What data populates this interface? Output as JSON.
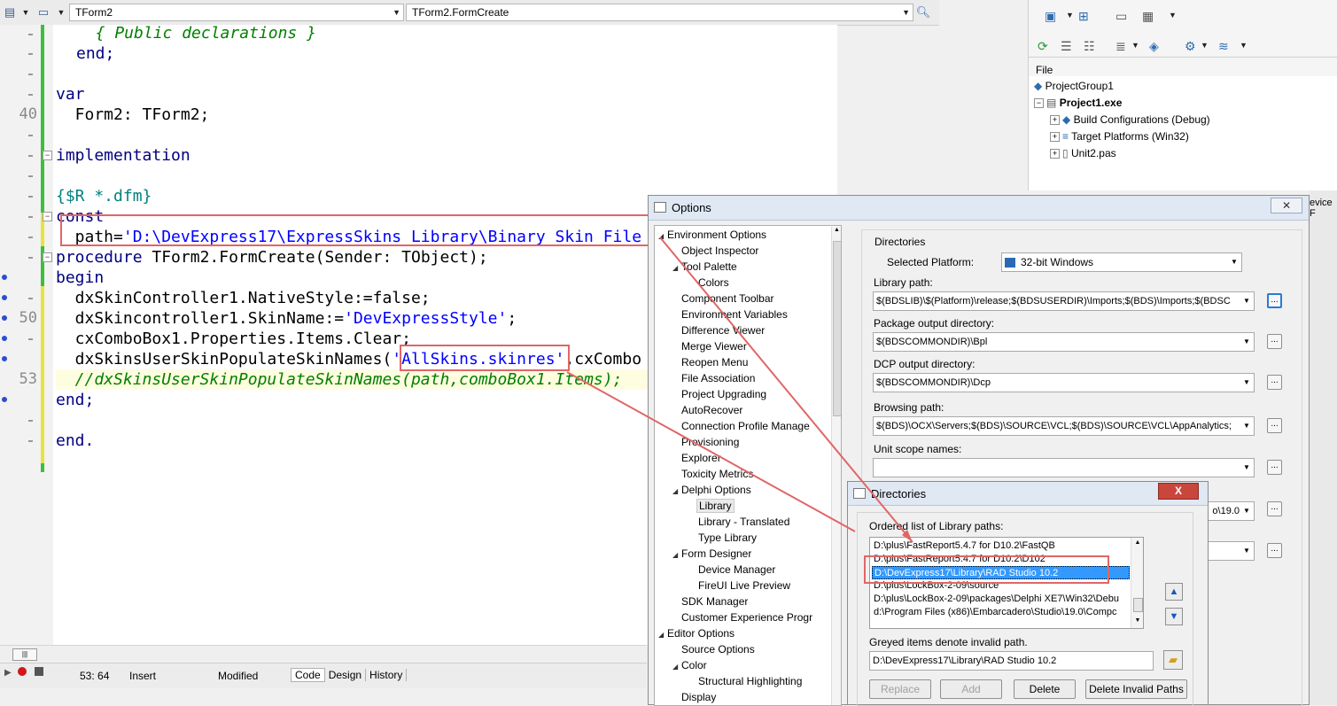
{
  "toolbar": {
    "unit_combo": "TForm2",
    "method_combo": "TForm2.FormCreate"
  },
  "code": {
    "l1": "  { Public declarations }",
    "l2": "end;",
    "l3": "var",
    "l4": "  Form2: TForm2;",
    "l5": "implementation",
    "l6": "{$R *.dfm}",
    "l7": "const",
    "l8a": "  path=",
    "l8b": "'D:\\DevExpress17\\ExpressSkins Library\\Binary Skin File",
    "l9a": "procedure",
    "l9b": " TForm2.FormCreate(Sender: TObject);",
    "l10": "begin",
    "l11": "  dxSkinController1.NativeStyle:=false;",
    "l12a": "  dxSkincontroller1.SkinName:=",
    "l12b": "'DevExpressStyle'",
    "l12c": ";",
    "l13": "  cxComboBox1.Properties.Items.Clear;",
    "l14a": "  dxSkinsUserSkinPopulateSkinNames(",
    "l14b": "'AllSkins.skinres'",
    "l14c": ",cxCombo",
    "l15": "  //dxSkinsUserSkinPopulateSkinNames(path,comboBox1.Items);",
    "l16": "end;",
    "l17": "end."
  },
  "line_numbers": {
    "n40": "40",
    "n50": "50",
    "n53": "53"
  },
  "status": {
    "position": "53: 64",
    "mode": "Insert",
    "modified": "Modified",
    "tab_code": "Code",
    "tab_design": "Design",
    "tab_history": "History"
  },
  "project": {
    "file_label": "File",
    "group": "ProjectGroup1",
    "project": "Project1.exe",
    "build_configs": "Build Configurations (Debug)",
    "target_platforms": "Target Platforms (Win32)",
    "unit": "Unit2.pas",
    "cut_label": "evice F"
  },
  "options": {
    "title": "Options",
    "tree": [
      "Environment Options",
      "Object Inspector",
      "Tool Palette",
      "Colors",
      "Component Toolbar",
      "Environment Variables",
      "Difference Viewer",
      "Merge Viewer",
      "Reopen Menu",
      "File Association",
      "Project Upgrading",
      "AutoRecover",
      "Connection Profile Manage",
      "Provisioning",
      "Explorer",
      "Toxicity Metrics",
      "Delphi Options",
      "Library",
      "Library - Translated",
      "Type Library",
      "Form Designer",
      "Device Manager",
      "FireUI Live Preview",
      "SDK Manager",
      "Customer Experience Progr",
      "Editor Options",
      "Source Options",
      "Color",
      "Structural Highlighting",
      "Display"
    ],
    "group_title": "Directories",
    "selected_platform_label": "Selected Platform:",
    "selected_platform_value": "32-bit Windows",
    "library_path_label": "Library path:",
    "library_path_value": "$(BDSLIB)\\$(Platform)\\release;$(BDSUSERDIR)\\Imports;$(BDS)\\Imports;$(BDSC",
    "package_output_label": "Package output directory:",
    "package_output_value": "$(BDSCOMMONDIR)\\Bpl",
    "dcp_output_label": "DCP output directory:",
    "dcp_output_value": "$(BDSCOMMONDIR)\\Dcp",
    "browsing_path_label": "Browsing path:",
    "browsing_path_value": "$(BDS)\\OCX\\Servers;$(BDS)\\SOURCE\\VCL;$(BDS)\\SOURCE\\VCL\\AppAnalytics;",
    "unit_scope_label": "Unit scope names:",
    "unit_scope_value": "",
    "hidden_field_value": "o\\19.0",
    "ellipsis": "..."
  },
  "directories": {
    "title": "Directories",
    "close": "X",
    "list_label": "Ordered list of Library paths:",
    "paths": [
      "D:\\plus\\FastReport5.4.7 for D10.2\\FastQB",
      "D:\\plus\\FastReport5.4.7 for D10.2\\D102",
      "D:\\DevExpress17\\Library\\RAD Studio 10.2",
      "D:\\plus\\LockBox-2-09\\source",
      "D:\\plus\\LockBox-2-09\\packages\\Delphi XE7\\Win32\\Debu",
      "d:\\Program Files (x86)\\Embarcadero\\Studio\\19.0\\Compc"
    ],
    "selected_index": 2,
    "greyed_note": "Greyed items denote invalid path.",
    "edit_value": "D:\\DevExpress17\\Library\\RAD Studio 10.2",
    "btn_replace": "Replace",
    "btn_add": "Add",
    "btn_delete": "Delete",
    "btn_delete_invalid": "Delete Invalid Paths"
  },
  "colors": {
    "accent_red": "#e06666",
    "selection": "#3399ff",
    "keyword": "#000080",
    "string": "#0000ff",
    "comment": "#008000"
  }
}
